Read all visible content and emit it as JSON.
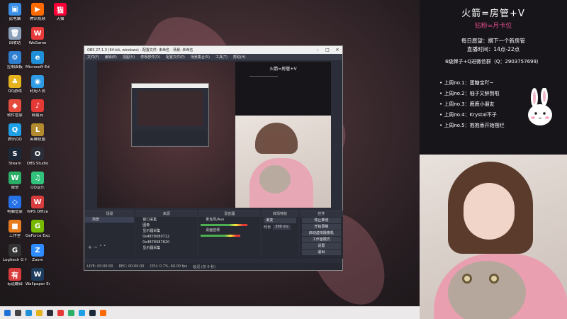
{
  "desktop_icons": [
    {
      "label": "此电脑",
      "color": "#3a8ee6",
      "glyph": "▣"
    },
    {
      "label": "回收站",
      "color": "#8aa0b8",
      "glyph": "🗑"
    },
    {
      "label": "控制面板",
      "color": "#2f7fd1",
      "glyph": "⚙"
    },
    {
      "label": "QQ游戏",
      "color": "#e6b31e",
      "glyph": "♣"
    },
    {
      "label": "软件管家",
      "color": "#e64c3c",
      "glyph": "◆"
    },
    {
      "label": "腾讯QQ",
      "color": "#1fa0e6",
      "glyph": "Q"
    },
    {
      "label": "Steam",
      "color": "#1b2838",
      "glyph": "S"
    },
    {
      "label": "微信",
      "color": "#2bae66",
      "glyph": "W"
    },
    {
      "label": "电脑管家",
      "color": "#2672e8",
      "glyph": "◇"
    },
    {
      "label": "工作室",
      "color": "#e67c1f",
      "glyph": "■"
    },
    {
      "label": "Logitech G HUB",
      "color": "#333",
      "glyph": "G"
    },
    {
      "label": "有道翻译",
      "color": "#d93c3c",
      "glyph": "有"
    },
    {
      "label": "腾讯视频",
      "color": "#ff6a00",
      "glyph": "▶"
    },
    {
      "label": "WeGame",
      "color": "#e83a3a",
      "glyph": "W"
    },
    {
      "label": "Microsoft Edge",
      "color": "#1e8fd8",
      "glyph": "e"
    },
    {
      "label": "利用人员",
      "color": "#2f9be6",
      "glyph": "◉"
    },
    {
      "label": "网易云",
      "color": "#e53935",
      "glyph": "♪"
    },
    {
      "label": "英雄联盟",
      "color": "#b38a2e",
      "glyph": "L"
    },
    {
      "label": "OBS Studio",
      "color": "#2b2e38",
      "glyph": "O"
    },
    {
      "label": "QQ音乐",
      "color": "#31c27c",
      "glyph": "♫"
    },
    {
      "label": "WPS Office",
      "color": "#d93c3c",
      "glyph": "W"
    },
    {
      "label": "GeForce Experience",
      "color": "#76b900",
      "glyph": "G"
    },
    {
      "label": "Zoom",
      "color": "#2d8cff",
      "glyph": "Z"
    },
    {
      "label": "Wallpaper Engine",
      "color": "#1d3b5c",
      "glyph": "W"
    },
    {
      "label": "天猫",
      "color": "#ff0036",
      "glyph": "猫"
    }
  ],
  "obs": {
    "title": "OBS 27.1.3 (64-bit, windows) - 配置文件: 未命名 - 场景: 未命名",
    "menu": [
      "文件(F)",
      "编辑(E)",
      "视图(V)",
      "停靠部件(D)",
      "配置文件(P)",
      "场景集合(S)",
      "工具(T)",
      "帮助(H)"
    ],
    "preview_title": "火箭=房管+V",
    "docks": {
      "scenes": {
        "header": "场景",
        "items": [
          "场景"
        ]
      },
      "sources": {
        "header": "来源",
        "items": [
          "窗口采集",
          "图像",
          "显示器采集",
          "0x4878080712",
          "0x4878087820",
          "显示器采集"
        ]
      },
      "mixer": {
        "header": "混音器",
        "items": [
          {
            "name": "麦克风/Aux",
            "level": 0.82
          },
          {
            "name": "桌面音频",
            "level": 0.7
          }
        ]
      },
      "transitions": {
        "header": "转场特效",
        "type": "渐变",
        "duration_label": "时长",
        "duration": "300 ms"
      },
      "controls": {
        "header": "控件",
        "buttons": [
          "停止推流",
          "开始录制",
          "启动虚拟摄像机",
          "工作室模式",
          "设置",
          "退出"
        ]
      }
    },
    "status": [
      "LIVE: 00:00:00",
      "REC: 00:00:00",
      "CPU: 0.7%, 60.00 fps",
      "延迟 (仅 0 秒)"
    ]
  },
  "side_panel": {
    "title": "火箭=房管+V",
    "subtitle": "钻粉=月卡位",
    "wish_line1": "每日愿望：摘下一个新房管",
    "wish_line2": "直播时间：14点-22点",
    "contact": "6级牌子+Q进微信群（Q：2903757699）",
    "ranks": [
      "上周no.1：蛋糖宝吖~",
      "上周no.2：柚子又醉到啦",
      "上周no.3：鹿鹿小朋友",
      "上周no.4：Krystal不子",
      "上周no.5：抱抱香开始摆烂"
    ],
    "accent": "#e04a8a"
  },
  "taskbar_icons": [
    "start-icon",
    "search-icon",
    "edge-icon",
    "explorer-icon",
    "obs-icon",
    "chrome-icon",
    "wechat-icon",
    "qq-icon",
    "steam-icon",
    "app-icon"
  ]
}
